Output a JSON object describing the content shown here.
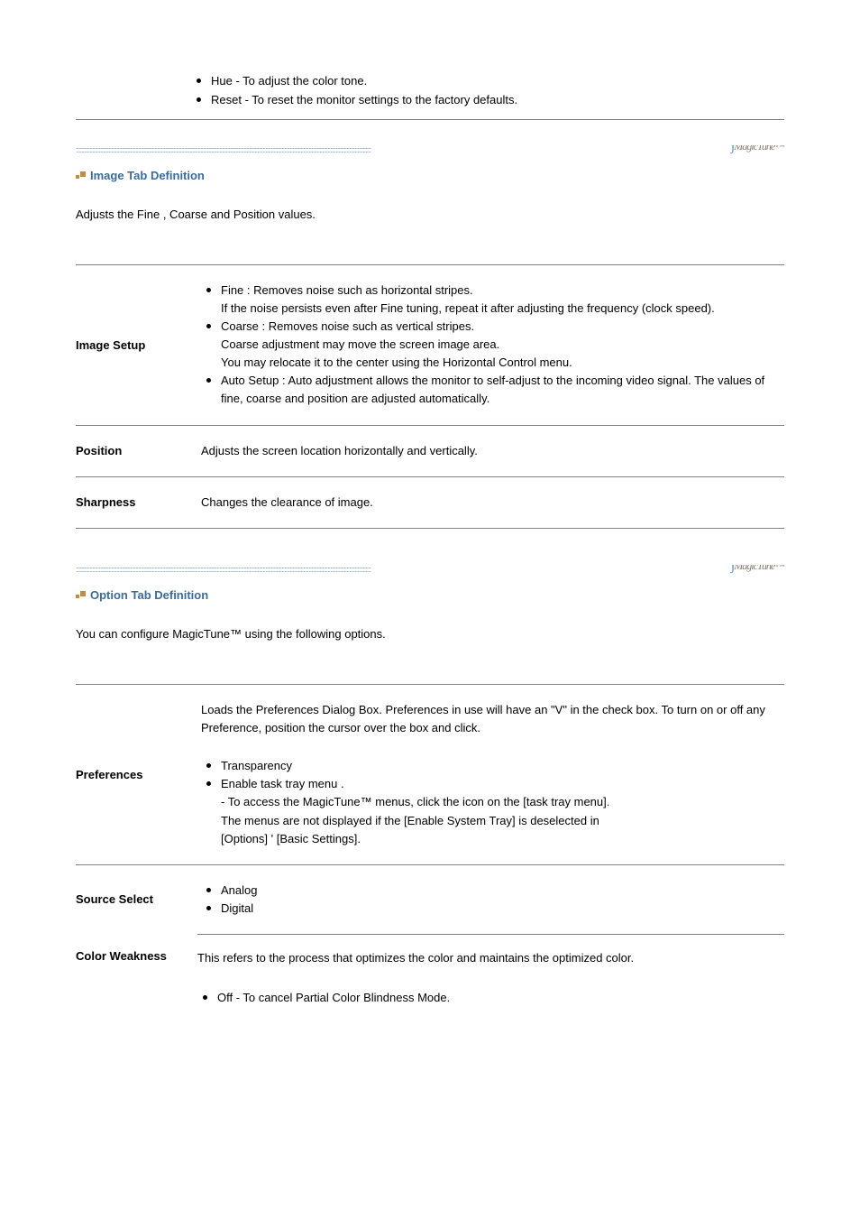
{
  "top": {
    "items": [
      "Hue - To adjust the color tone.",
      "Reset - To reset the monitor settings to the factory defaults."
    ]
  },
  "logo": "MagicTune™",
  "imageTab": {
    "title": "Image Tab Definition",
    "intro": "Adjusts the Fine , Coarse and Position values.",
    "rows": {
      "imageSetup": {
        "label": "Image Setup",
        "bullets": [
          {
            "lead": "Fine : Removes noise such as horizontal stripes.",
            "subs": [
              "If the noise persists even after Fine tuning, repeat it after adjusting the frequency (clock speed)."
            ]
          },
          {
            "lead": "Coarse : Removes noise such as vertical stripes.",
            "subs": [
              "Coarse adjustment may move the screen image area.",
              "You may relocate it to the center using the Horizontal Control menu."
            ]
          },
          {
            "lead": "Auto Setup : Auto adjustment allows the monitor to self-adjust to the incoming video signal. The values of fine, coarse and position are adjusted automatically.",
            "subs": []
          }
        ]
      },
      "position": {
        "label": "Position",
        "text": "Adjusts the screen location horizontally and vertically."
      },
      "sharpness": {
        "label": "Sharpness",
        "text": "Changes the clearance of image."
      }
    }
  },
  "optionTab": {
    "title": "Option Tab Definition",
    "intro": "You can configure MagicTune™ using the following options.",
    "rows": {
      "preferences": {
        "label": "Preferences",
        "lead": "Loads the Preferences Dialog Box. Preferences in use will have an \"V\" in the check box. To turn on or off any Preference, position the cursor over the box and click.",
        "bullets": [
          {
            "lead": "Transparency",
            "subs": []
          },
          {
            "lead": "Enable task tray menu .",
            "subs": [
              "- To access the MagicTune™ menus, click the icon on the [task tray menu].",
              "  The menus are not displayed if the [Enable System Tray] is deselected in",
              "  [Options] ' [Basic Settings]."
            ]
          }
        ]
      },
      "sourceSelect": {
        "label": "Source Select",
        "bullets": [
          {
            "lead": "Analog"
          },
          {
            "lead": "Digital"
          }
        ]
      },
      "colorWeakness": {
        "label": "Color Weakness",
        "lead": "This refers to the process that optimizes the color and maintains the optimized color.",
        "bullets": [
          {
            "lead": "Off - To cancel Partial Color Blindness Mode."
          }
        ]
      }
    }
  }
}
